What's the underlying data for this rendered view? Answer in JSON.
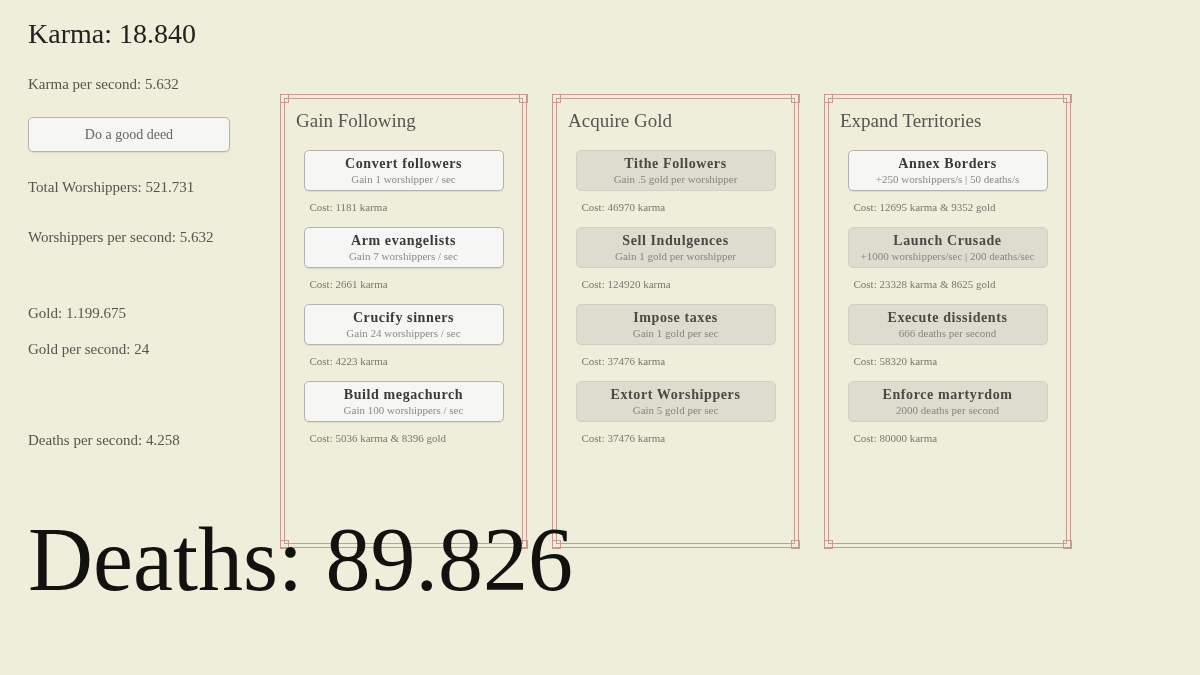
{
  "stats": {
    "karma": "Karma: 18.840",
    "karma_per_second": "Karma per second: 5.632",
    "deed_button": "Do a good deed",
    "total_worshippers": "Total Worshippers: 521.731",
    "worshippers_per_second": "Worshippers per second: 5.632",
    "gold": "Gold: 1.199.675",
    "gold_per_second": "Gold per second: 24",
    "deaths_per_second": "Deaths per second: 4.258"
  },
  "panels": [
    {
      "title": "Gain Following",
      "upgrades": [
        {
          "name": "Convert followers",
          "effect": "Gain 1 worshipper / sec",
          "cost": "Cost: 1181 karma",
          "disabled": false
        },
        {
          "name": "Arm evangelists",
          "effect": "Gain 7 worshippers / sec",
          "cost": "Cost: 2661 karma",
          "disabled": false
        },
        {
          "name": "Crucify sinners",
          "effect": "Gain 24 worshippers / sec",
          "cost": "Cost: 4223 karma",
          "disabled": false
        },
        {
          "name": "Build megachurch",
          "effect": "Gain 100 worshippers / sec",
          "cost": "Cost: 5036 karma & 8396 gold",
          "disabled": false
        }
      ]
    },
    {
      "title": "Acquire Gold",
      "upgrades": [
        {
          "name": "Tithe Followers",
          "effect": "Gain .5 gold per worshipper",
          "cost": "Cost: 46970 karma",
          "disabled": true
        },
        {
          "name": "Sell Indulgences",
          "effect": "Gain 1 gold per worshipper",
          "cost": "Cost: 124920 karma",
          "disabled": true
        },
        {
          "name": "Impose taxes",
          "effect": "Gain 1 gold per sec",
          "cost": "Cost: 37476 karma",
          "disabled": true
        },
        {
          "name": "Extort Worshippers",
          "effect": "Gain 5 gold per sec",
          "cost": "Cost: 37476 karma",
          "disabled": true
        }
      ]
    },
    {
      "title": "Expand Territories",
      "upgrades": [
        {
          "name": "Annex Borders",
          "effect": "+250 worshippers/s | 50 deaths/s",
          "cost": "Cost: 12695 karma & 9352 gold",
          "disabled": false
        },
        {
          "name": "Launch Crusade",
          "effect": "+1000 worshippers/sec | 200 deaths/sec",
          "cost": "Cost: 23328 karma & 8625 gold",
          "disabled": true
        },
        {
          "name": "Execute dissidents",
          "effect": "666 deaths per second",
          "cost": "Cost: 58320 karma",
          "disabled": true
        },
        {
          "name": "Enforce martyrdom",
          "effect": "2000 deaths per second",
          "cost": "Cost: 80000 karma",
          "disabled": true
        }
      ]
    }
  ],
  "deaths": "Deaths: 89.826"
}
